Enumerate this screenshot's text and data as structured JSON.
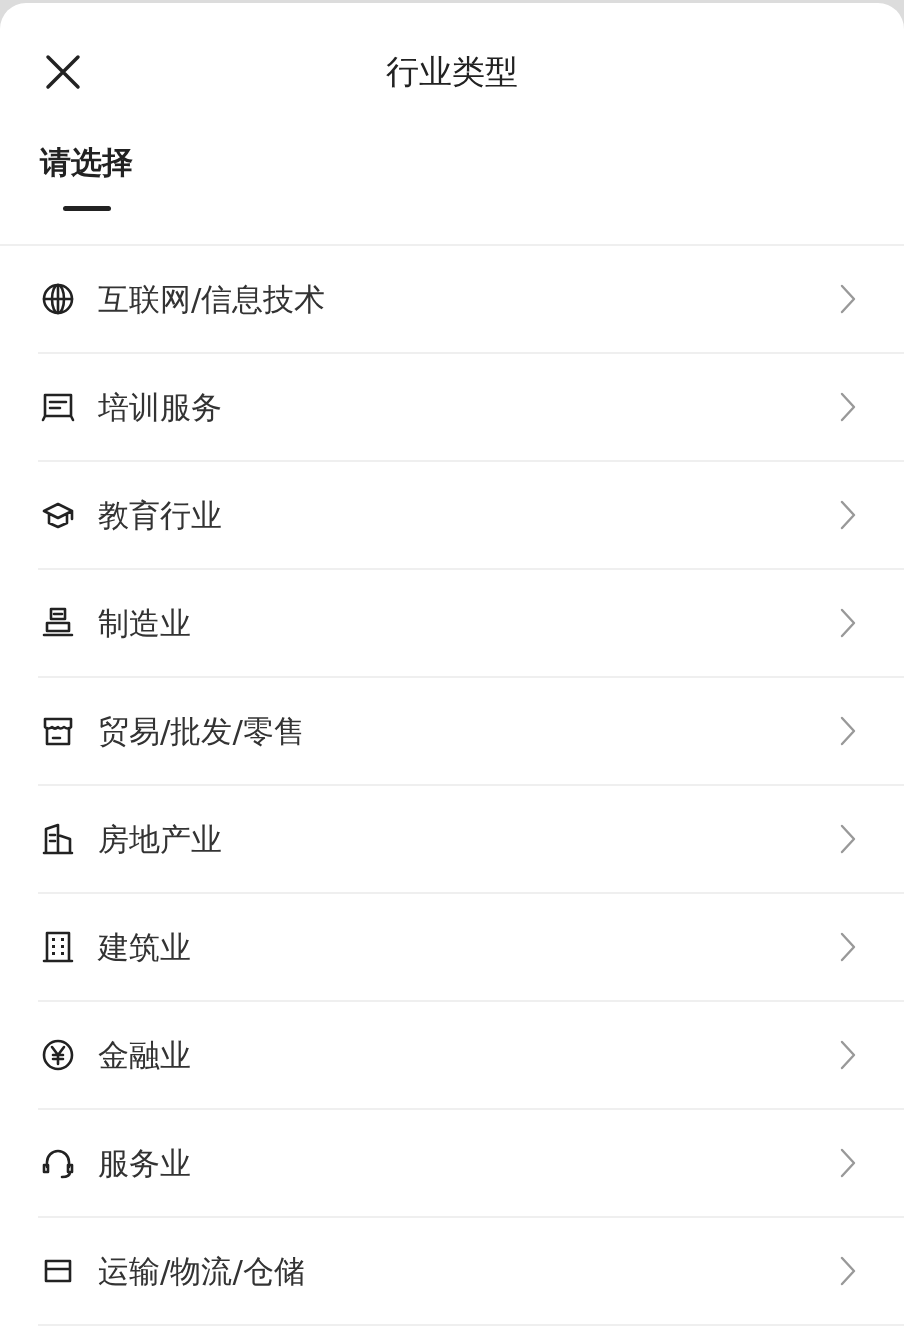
{
  "sheet": {
    "title": "行业类型"
  },
  "tabs": [
    {
      "label": "请选择",
      "selected": true
    }
  ],
  "items": [
    {
      "label": "互联网/信息技术"
    },
    {
      "label": "培训服务"
    },
    {
      "label": "教育行业"
    },
    {
      "label": "制造业"
    },
    {
      "label": "贸易/批发/零售"
    },
    {
      "label": "房地产业"
    },
    {
      "label": "建筑业"
    },
    {
      "label": "金融业"
    },
    {
      "label": "服务业"
    },
    {
      "label": "运输/物流/仓储"
    }
  ]
}
